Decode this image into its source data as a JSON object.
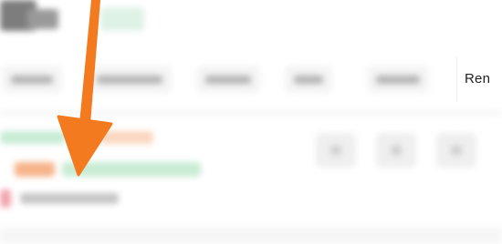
{
  "tabs": {
    "active_label": "Ren"
  },
  "colors": {
    "annotation_arrow": "#f47a20",
    "background": "#ffffff"
  },
  "annotation": {
    "icon": "down-arrow-icon"
  }
}
